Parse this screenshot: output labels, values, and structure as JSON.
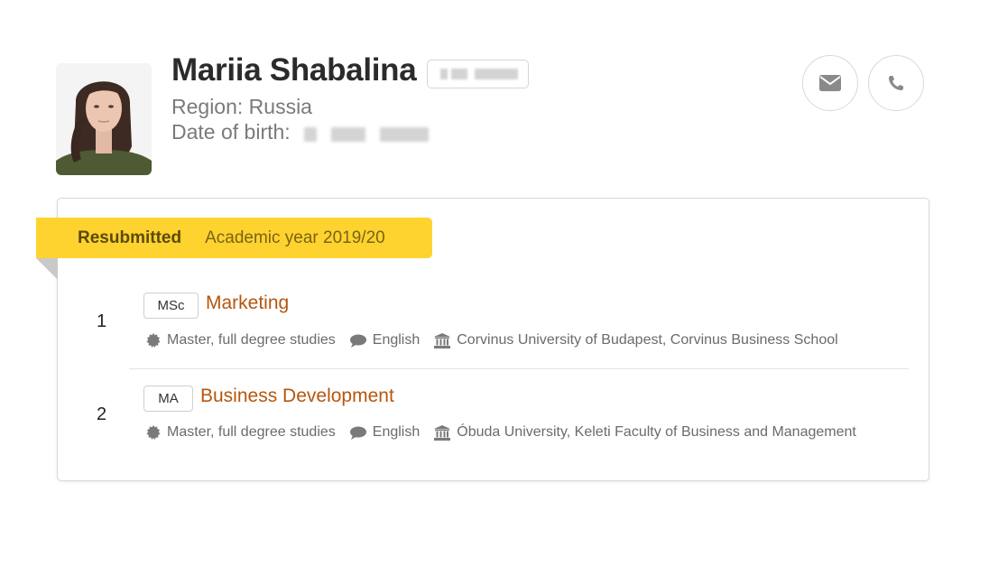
{
  "profile": {
    "name": "Mariia Shabalina",
    "region_label": "Region: Russia",
    "dob_label": "Date of birth:"
  },
  "actions": [
    {
      "icon": "envelope-icon",
      "label": "email"
    },
    {
      "icon": "phone-icon",
      "label": "phone"
    }
  ],
  "application": {
    "status": "Resubmitted",
    "year": "Academic year 2019/20",
    "colors": {
      "ribbon": "#fed330",
      "title": "#b5560e"
    },
    "programs": [
      {
        "rank": "1",
        "degree": "MSc",
        "title": "Marketing",
        "level": "Master, full degree studies",
        "language": "English",
        "institution": "Corvinus University of Budapest, Corvinus Business School"
      },
      {
        "rank": "2",
        "degree": "MA",
        "title": "Business Development",
        "level": "Master, full degree studies",
        "language": "English",
        "institution": "Óbuda University, Keleti Faculty of Business and Management"
      }
    ]
  }
}
